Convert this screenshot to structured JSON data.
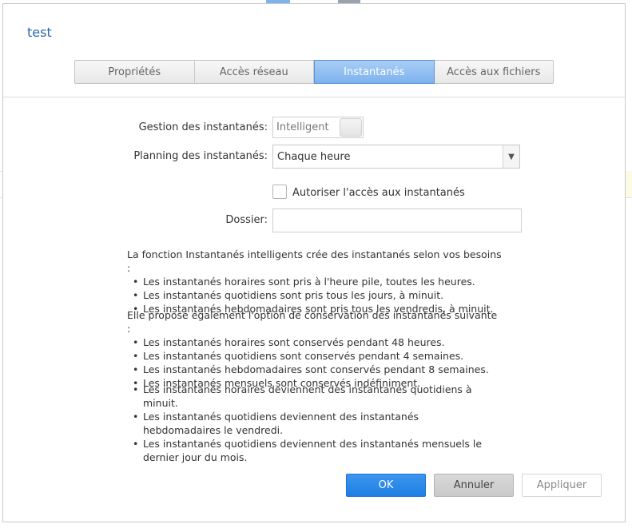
{
  "dialog": {
    "title": "test",
    "tabs": [
      {
        "label": "Propriétés",
        "active": false
      },
      {
        "label": "Accès réseau",
        "active": false
      },
      {
        "label": "Instantanés",
        "active": true
      },
      {
        "label": "Accès aux fichiers",
        "active": false
      }
    ]
  },
  "form": {
    "snapshot_management": {
      "label": "Gestion des instantanés:",
      "value": "Intelligent"
    },
    "snapshot_schedule": {
      "label": "Planning des instantanés:",
      "value": "Chaque heure"
    },
    "allow_access": {
      "label": "Autoriser l'accès aux instantanés",
      "checked": false
    },
    "folder": {
      "label": "Dossier:",
      "value": ""
    }
  },
  "description": {
    "intro": "La fonction Instantanés intelligents crée des instantanés selon vos besoins :",
    "creation": [
      "Les instantanés horaires sont pris à l'heure pile, toutes les heures.",
      "Les instantanés quotidiens sont pris tous les jours, à minuit.",
      "Les instantanés hebdomadaires sont pris tous les vendredis, à minuit."
    ],
    "retention_intro": "Elle propose également l'option de conservation des instantanés suivante :",
    "retention": [
      "Les instantanés horaires sont conservés pendant 48 heures.",
      "Les instantanés quotidiens sont conservés pendant 4 semaines.",
      "Les instantanés hebdomadaires sont conservés pendant 8 semaines.",
      "Les instantanés mensuels sont conservés indéfiniment."
    ],
    "promotion": [
      "Les instantanés horaires deviennent des instantanés quotidiens à minuit.",
      "Les instantanés quotidiens deviennent des instantanés hebdomadaires le vendredi.",
      "Les instantanés quotidiens deviennent des instantanés mensuels le dernier jour du mois."
    ]
  },
  "buttons": {
    "ok": "OK",
    "cancel": "Annuler",
    "apply": "Appliquer"
  },
  "colors": {
    "accent": "#1e7fe3",
    "title": "#2a6ab0",
    "active_tab": "#7db2ee"
  },
  "icons": {
    "select_arrow": "chevron-down-icon"
  }
}
